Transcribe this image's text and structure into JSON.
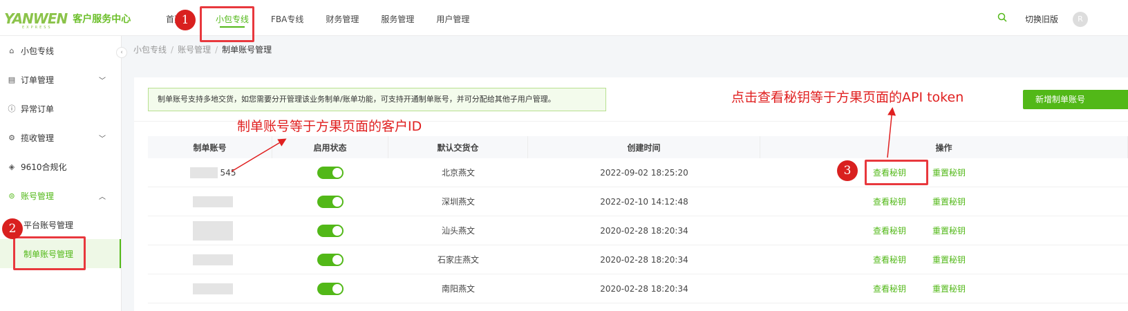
{
  "logo": {
    "mark": "YANWEN",
    "sub": "EXPRESS",
    "title": "客户服务中心"
  },
  "nav": [
    "首页",
    "小包专线",
    "FBA专线",
    "财务管理",
    "服务管理",
    "用户管理"
  ],
  "header": {
    "old_version": "切换旧版",
    "avatar_letter": "R"
  },
  "sidebar": {
    "items": [
      {
        "label": "小包专线",
        "icon": "home-icon"
      },
      {
        "label": "订单管理",
        "icon": "order-icon"
      },
      {
        "label": "异常订单",
        "icon": "alert-icon"
      },
      {
        "label": "揽收管理",
        "icon": "pickup-icon"
      },
      {
        "label": "9610合规化",
        "icon": "shield-icon"
      },
      {
        "label": "账号管理",
        "icon": "account-icon"
      }
    ],
    "subitems": [
      "平台账号管理",
      "制单账号管理"
    ]
  },
  "breadcrumb": [
    "小包专线",
    "账号管理",
    "制单账号管理"
  ],
  "notice": "制单账号支持多地交货，如您需要分开管理该业务制单/账单功能，可支持开通制单账号，并可分配给其他子用户管理。",
  "add_button": "新增制单账号",
  "table": {
    "headers": [
      "制单账号",
      "启用状态",
      "默认交货仓",
      "创建时间",
      "操作"
    ],
    "rows": [
      {
        "account": "545",
        "warehouse": "北京燕文",
        "created": "2022-09-02 18:25:20",
        "enabled": true
      },
      {
        "account": "",
        "warehouse": "深圳燕文",
        "created": "2022-02-10 14:12:48",
        "enabled": true
      },
      {
        "account": "",
        "warehouse": "汕头燕文",
        "created": "2020-02-28 18:20:34",
        "enabled": true
      },
      {
        "account": "",
        "warehouse": "石家庄燕文",
        "created": "2020-02-28 18:20:34",
        "enabled": true
      },
      {
        "account": "",
        "warehouse": "南阳燕文",
        "created": "2020-02-28 18:20:34",
        "enabled": true
      }
    ],
    "op_view": "查看秘钥",
    "op_reset": "重置秘钥"
  },
  "annotations": {
    "account_note": "制单账号等于方果页面的客户ID",
    "key_note": "点击查看秘钥等于方果页面的API token",
    "step1": "1",
    "step2": "2",
    "step3": "3"
  },
  "colors": {
    "brand": "#52b818",
    "annotation": "#e02020"
  }
}
